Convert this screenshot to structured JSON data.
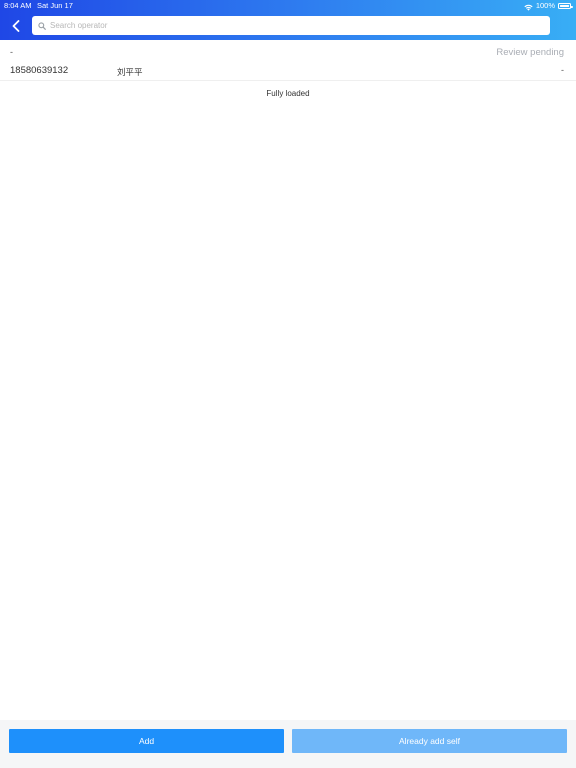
{
  "status_bar": {
    "time": "8:04 AM",
    "date": "Sat Jun 17",
    "battery": "100%"
  },
  "header": {
    "search_placeholder": "Search operator"
  },
  "list": [
    {
      "top_left": "-",
      "status": "Review pending",
      "phone": "18580639132",
      "name": "刘平平",
      "bottom_right": "-"
    }
  ],
  "footer_text": "Fully loaded",
  "buttons": {
    "add": "Add",
    "already_add_self": "Already add self"
  }
}
